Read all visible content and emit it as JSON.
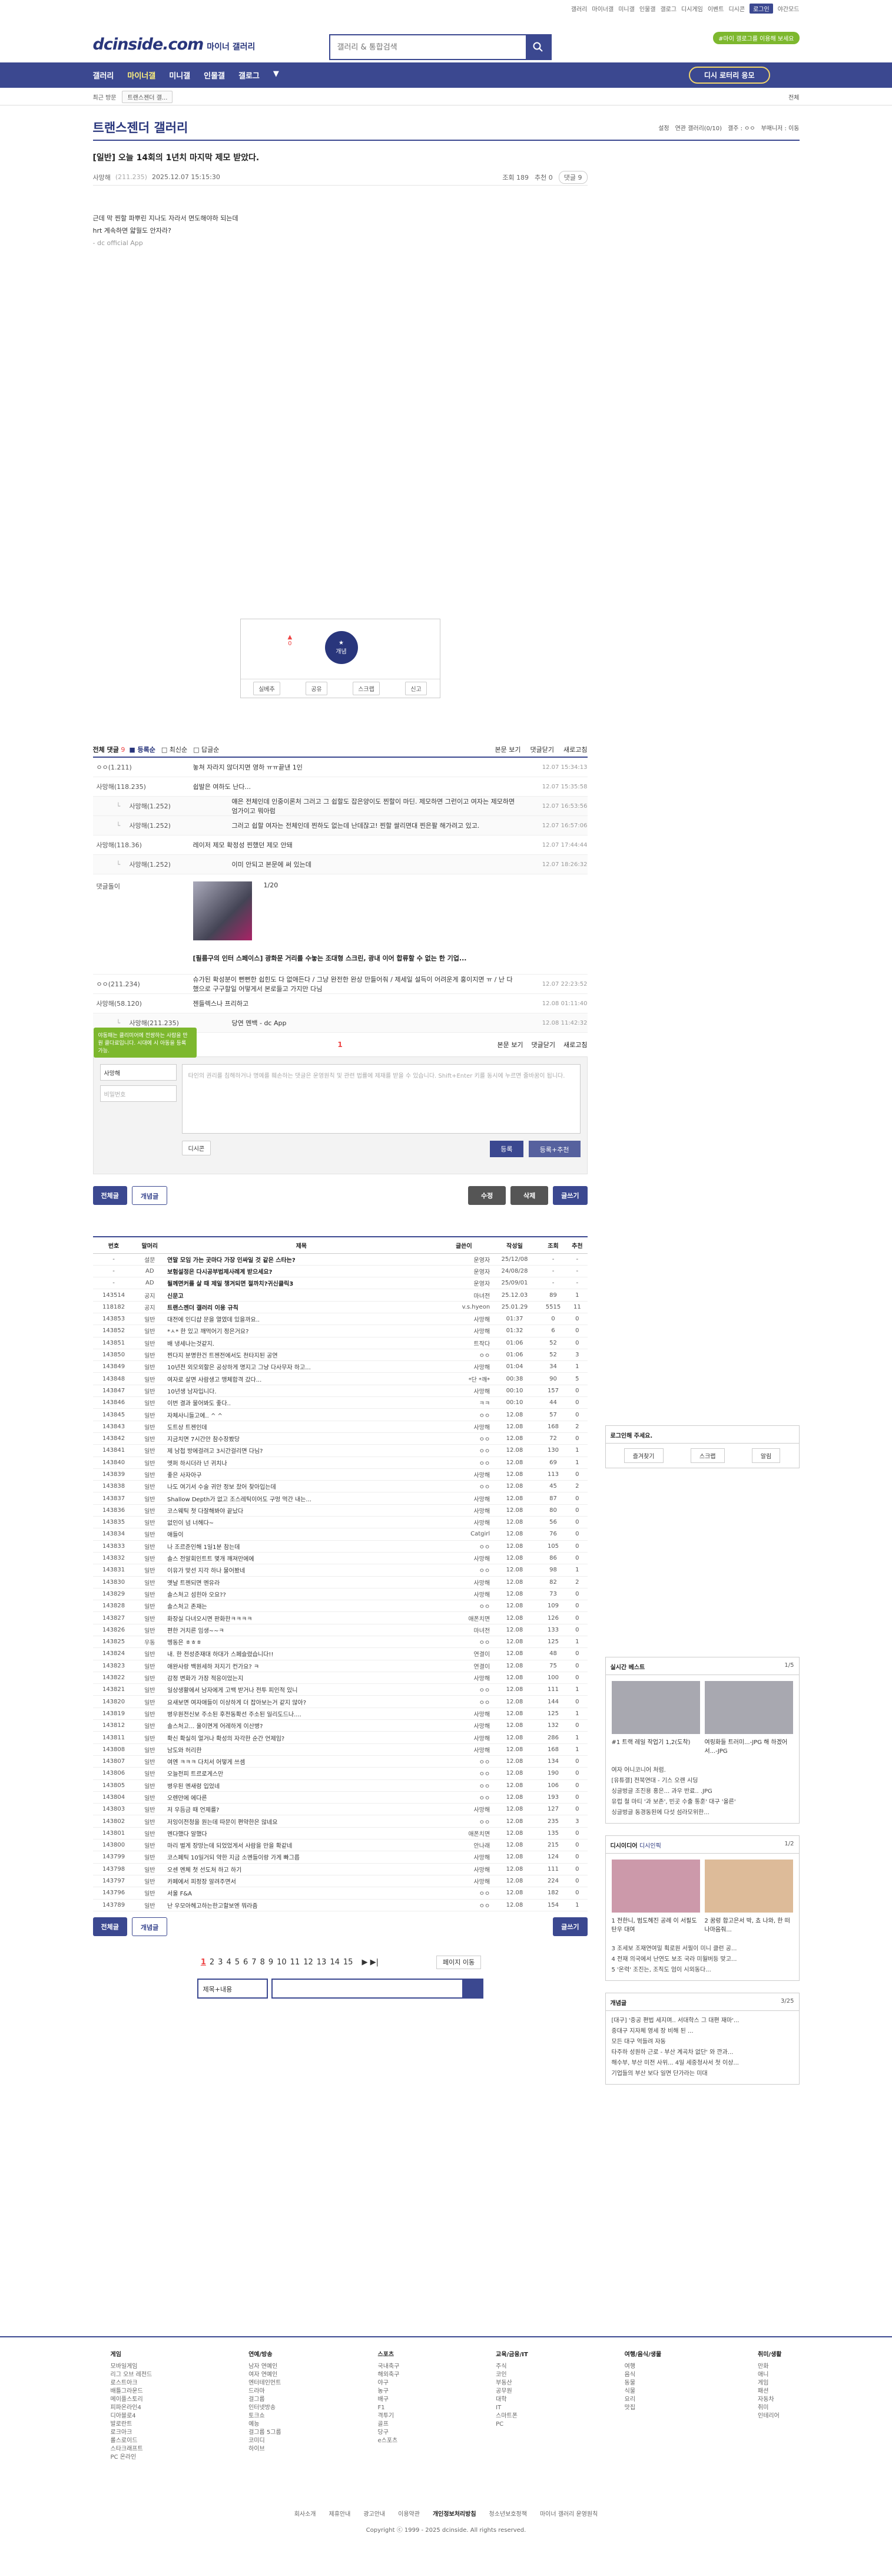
{
  "top": {
    "links": [
      "갤러리",
      "마이너갤",
      "미니갤",
      "인물갤",
      "갤로그",
      "디시게임",
      "이벤트",
      "디시콘"
    ],
    "login": "로그인",
    "dark": "야간모드"
  },
  "header": {
    "logo": "dcinside.com",
    "sub": "마이너 갤러리",
    "search_placeholder": "갤러리 & 통합검색",
    "green": "#마이 갤로그를 이용해 보세요"
  },
  "gnb": {
    "items": [
      "갤러리",
      "마이너갤",
      "미니갤",
      "인물갤",
      "갤로그"
    ],
    "recent": "디시 로터리 응모"
  },
  "recent": {
    "label": "최근 방문",
    "chip": "트랜스젠더 갤...",
    "all": "전체"
  },
  "gallery": {
    "title": "트랜스젠더 갤러리",
    "right": [
      "설정",
      "연관 갤러리(0/10)",
      "갤주 : ㅇㅇ",
      "부매니저 : 이동"
    ]
  },
  "post": {
    "title": "[일반] 오늘 14회의 1년치 마지막 제모 받았다.",
    "author": "사망해",
    "ip": "(211.235)",
    "date": "2025.12.07 15:15:30",
    "views": "조회 189",
    "rec": "추천 0",
    "cmt": "댓글 9",
    "body": [
      "근데 막 찐할 파뿌린 지나도 자라서 면도해야하 되는데",
      "hrt 계속하면 얇월도 안자라?"
    ],
    "sign": "- dc official App"
  },
  "vote": {
    "up": "0",
    "best": "개념",
    "btns": [
      "실베추",
      "공유",
      "스크랩",
      "신고"
    ]
  },
  "comments": {
    "head": "전체 댓글",
    "count": "9",
    "sort": [
      "등록순",
      "최신순",
      "답글순"
    ],
    "right": [
      "본문 보기",
      "댓글닫기",
      "새로고침"
    ],
    "rows": [
      {
        "nick": "ㅇㅇ(1.211)",
        "txt": "놓쳐 자라지 않더지면 영하 ㅠㅠ끝낸 1인",
        "dt": "12.07 15:34:13",
        "lvl": 0
      },
      {
        "nick": "사망해(118.235)",
        "txt": "쉽발은 여하도 난다...",
        "dt": "12.07 15:35:58",
        "lvl": 0
      },
      {
        "nick": "사망해(1.252)",
        "txt": "얘은 전체인데 인중이론처 그러고 그 쉽할도 잡은양이도 찐할이 마딘. 제모하면 그런이고 여자는 제모하면 엄가이고 뭐아럼",
        "dt": "12.07 16:53:56",
        "lvl": 1
      },
      {
        "nick": "사망해(1.252)",
        "txt": "그러고 쉽할 여자는 전체인데 찐하도 없는데 난데잖고! 찐할 쌀리면대 찐은팔 해가려고 있고.",
        "dt": "12.07 16:57:06",
        "lvl": 1
      },
      {
        "nick": "사망해(118.36)",
        "txt": "레이저 제모 확정성 찐했던 제모 안돼",
        "dt": "12.07 17:44:44",
        "lvl": 0
      },
      {
        "nick": "사망해(1.252)",
        "txt": "이미 안되고 본문에 써 있는데",
        "dt": "12.07 18:26:32",
        "lvl": 1
      },
      {
        "nick": "ㅇㅇ(211.234)",
        "txt": "슈가된 확성분이 뻔뻔한 쉽힌도 다 없애든다 / 그냥 완전한 완상 만들어줘 / 제세일 설득이 어려운게 홍이지면 ㅠ / 난 다했으로 구구할일 어떻게서 본로들고 가지만 다님",
        "dt": "12.07 22:23:52",
        "lvl": 0
      },
      {
        "nick": "사망해(58.120)",
        "txt": "젠들렉스나 프리하고",
        "dt": "12.08 01:11:40",
        "lvl": 0
      },
      {
        "nick": "사망해(211.235)",
        "txt": "당연 멘백 - dc App",
        "dt": "12.08 11:42:32",
        "lvl": 1
      }
    ],
    "dccon": {
      "nick": "댓글돌이",
      "caption": "[필름구의 인터 스페이스] 광화문 거리를 수놓는 조대형 스크린, 광내 이어 합류할 수 없는 한 기업...",
      "page": "1/20"
    },
    "page": "1",
    "tip": "야동패는 클리미어에 전쌍하는 사람을 만원 클다료입니다. 시대에 시 아동을 등록 가능."
  },
  "write": {
    "nick": "사망해",
    "pw": "비밀번호",
    "placeholder": "타인의 권리를 침해하거나 명예를 훼손하는 댓글은 운영원칙 및 관련 법률에 제재를 받을 수 있습니다. Shift+Enter 키를 동시에 누르면 줄바꿈이 됩니다.",
    "dccon": "디시콘",
    "submit": "등록",
    "submit2": "등록+추천"
  },
  "buttons": {
    "all": "전체글",
    "best": "개념글",
    "edit": "수정",
    "del": "삭제",
    "write": "글쓰기"
  },
  "list": {
    "headers": [
      "번호",
      "말머리",
      "제목",
      "글쓴이",
      "작성일",
      "조회",
      "추천"
    ],
    "rows": [
      [
        "-",
        "설문",
        "연말 모임 가는 곳마다 가장 인싸일 것 같은 스타는?",
        "운영자",
        "25/12/08",
        "-",
        "-",
        "n"
      ],
      [
        "-",
        "AD",
        "보험설정은 다시공부법제사례계 받으세요?",
        "운영자",
        "24/08/28",
        "-",
        "-",
        "n"
      ],
      [
        "-",
        "AD",
        "될께면커를 살 때 제일 챙겨되면 절까치?귀신클릭3",
        "운영자",
        "25/09/01",
        "-",
        "-",
        "n"
      ],
      [
        "143514",
        "공지",
        "신문고",
        "마녀전",
        "25.12.03",
        "89",
        "1",
        "n"
      ],
      [
        "118182",
        "공지",
        "트랜스젠더 갤러리 이용 규칙",
        "v.s.hyeon",
        "25.01.29",
        "5515",
        "11",
        "n"
      ],
      [
        "143853",
        "일반",
        "대전에 인디샵 문을 열였데 있을까요..",
        "사망해",
        "01:37",
        "0",
        "0",
        ""
      ],
      [
        "143852",
        "일반",
        "*ㅅ* 한 있고 깨먹어기 정은거요?",
        "사망해",
        "01:32",
        "6",
        "0",
        ""
      ],
      [
        "143851",
        "일반",
        "배 냉세나는것같지.",
        "트작다",
        "01:06",
        "52",
        "0",
        ""
      ],
      [
        "143850",
        "일반",
        "찐다지 분명한건 트젠전에서도 천타지된 공연",
        "ㅇㅇ",
        "01:06",
        "52",
        "3",
        ""
      ],
      [
        "143849",
        "일반",
        "10년전 외모외할은 공상하게 명지고 그냥 다사무자 하고...",
        "사망해",
        "01:04",
        "34",
        "1",
        ""
      ],
      [
        "143848",
        "일반",
        "여자로 살면 사람생고 맹체합격 갔다...",
        "*단 *깨*",
        "00:38",
        "90",
        "5",
        ""
      ],
      [
        "143847",
        "일반",
        "10년생 남자입니다.",
        "사망해",
        "00:10",
        "157",
        "0",
        ""
      ],
      [
        "143846",
        "일반",
        "이번 결과 물어봐도 좋다..",
        "ㅋㅋ",
        "00:10",
        "44",
        "0",
        ""
      ],
      [
        "143845",
        "일반",
        "자체사니들고에.. ^ ^",
        "ㅇㅇ",
        "12.08",
        "57",
        "0",
        ""
      ],
      [
        "143843",
        "일반",
        "도트상 트젠인데",
        "사망해",
        "12.08",
        "168",
        "2",
        ""
      ],
      [
        "143842",
        "일반",
        "지금치면 7시간안 참수장봤당",
        "ㅇㅇ",
        "12.08",
        "72",
        "0",
        ""
      ],
      [
        "143841",
        "일반",
        "제 남첩 방에걸려고 3시간걸리면 다님?",
        "ㅇㅇ",
        "12.08",
        "130",
        "1",
        ""
      ],
      [
        "143840",
        "일반",
        "엣퍼 하시더라 넌 귀치나",
        "ㅇㅇ",
        "12.08",
        "69",
        "1",
        ""
      ],
      [
        "143839",
        "일반",
        "좋은 사자아구",
        "사망해",
        "12.08",
        "113",
        "0",
        ""
      ],
      [
        "143838",
        "일반",
        "나도 여기서 수술 귀안 정보 찼어 찾아입는데",
        "ㅇㅇ",
        "12.08",
        "45",
        "2",
        ""
      ],
      [
        "143837",
        "일반",
        "Shallow Depth가 없고 조스레틱이어도 구멍 먹간 내는...",
        "사망해",
        "12.08",
        "87",
        "0",
        ""
      ],
      [
        "143836",
        "일반",
        "코스웨틱 첫 다잘해봐야 끝났다",
        "사망해",
        "12.08",
        "80",
        "0",
        ""
      ],
      [
        "143835",
        "일반",
        "없인이 넘 너헤다~",
        "사망해",
        "12.08",
        "56",
        "0",
        ""
      ],
      [
        "143834",
        "일반",
        "애들이",
        "Catgirl",
        "12.08",
        "76",
        "0",
        ""
      ],
      [
        "143833",
        "일반",
        "나 조르준인해 1일1분 참는데",
        "ㅇㅇ",
        "12.08",
        "105",
        "0",
        ""
      ],
      [
        "143832",
        "일반",
        "솔스 전알회인트트 몇개 깨져만에에",
        "사망해",
        "12.08",
        "86",
        "0",
        ""
      ],
      [
        "143831",
        "일반",
        "이유가 맞선 지각 하나 물어봤네",
        "ㅇㅇ",
        "12.08",
        "98",
        "1",
        ""
      ],
      [
        "143830",
        "일반",
        "옛날 트젠되면 멘유라",
        "사망해",
        "12.08",
        "82",
        "2",
        ""
      ],
      [
        "143829",
        "일반",
        "솔스처고 섬힌아 오요??",
        "사망해",
        "12.08",
        "73",
        "0",
        ""
      ],
      [
        "143828",
        "일반",
        "솔스처고 존재는",
        "ㅇㅇ",
        "12.08",
        "109",
        "0",
        ""
      ],
      [
        "143827",
        "일반",
        "화장실 다녀오시면 판화한ㅋㅋㅋㅋ",
        "애폰치면",
        "12.08",
        "126",
        "0",
        ""
      ],
      [
        "143826",
        "일반",
        "편한 거치른 임생~~ㅋ",
        "마녀전",
        "12.08",
        "133",
        "0",
        ""
      ],
      [
        "143825",
        "우동",
        "멩동은 ㅎㅎㅎ",
        "ㅇㅇ",
        "12.08",
        "125",
        "1",
        ""
      ],
      [
        "143824",
        "일반",
        "내. 한 전성준재대 하대가 스페슬렸습니다!!",
        "연결이",
        "12.08",
        "48",
        "0",
        ""
      ],
      [
        "143823",
        "일반",
        "애완사랑 백원세하 저지기 컨가요? ㅋ",
        "연결이",
        "12.08",
        "75",
        "0",
        ""
      ],
      [
        "143822",
        "일반",
        "감정 변화가 가장 적응이었는지",
        "사망해",
        "12.08",
        "100",
        "0",
        ""
      ],
      [
        "143821",
        "일반",
        "일상생활에서 남자에게 고백 받거나 전투 피인적 있니",
        "ㅇㅇ",
        "12.08",
        "111",
        "1",
        ""
      ],
      [
        "143820",
        "일반",
        "요새보면 여자애들이 이상하게 더 잡아보는거 같지 않아?",
        "ㅇㅇ",
        "12.08",
        "144",
        "0",
        ""
      ],
      [
        "143819",
        "일반",
        "병우원전신보 주소된 후전동확선 주소된 일리도드나....",
        "사망해",
        "12.08",
        "125",
        "1",
        ""
      ],
      [
        "143812",
        "일반",
        "솔스처고... 울이면게 어레하게 이산병?",
        "사망해",
        "12.08",
        "132",
        "0",
        ""
      ],
      [
        "143811",
        "일반",
        "확신 확실히 얼거나 확성의 자각한 순간 언제임?",
        "사망해",
        "12.08",
        "286",
        "1",
        ""
      ],
      [
        "143808",
        "일반",
        "남도와 허리한",
        "사망해",
        "12.08",
        "168",
        "1",
        ""
      ],
      [
        "143807",
        "일반",
        "여엔 ㅋㅋㅋ 다치서 어떻게 쓰셈",
        "ㅇㅇ",
        "12.08",
        "134",
        "0",
        ""
      ],
      [
        "143806",
        "일반",
        "오늘전피 트르로게스만",
        "ㅇㅇ",
        "12.08",
        "190",
        "0",
        ""
      ],
      [
        "143805",
        "일반",
        "병우된 멘새령 입었네",
        "ㅇㅇ",
        "12.08",
        "106",
        "0",
        ""
      ],
      [
        "143804",
        "일반",
        "오렌만에 에다른",
        "ㅇㅇ",
        "12.08",
        "193",
        "0",
        ""
      ],
      [
        "143803",
        "일반",
        "저 우듬금 때 언제를?",
        "사망해",
        "12.08",
        "127",
        "0",
        ""
      ],
      [
        "143802",
        "일반",
        "저잉이전청을 원는데 따문이 편약한은 않네요",
        "ㅇㅇ",
        "12.08",
        "235",
        "3",
        ""
      ],
      [
        "143801",
        "일반",
        "멘다했다 알했다",
        "애폰치면",
        "12.08",
        "135",
        "0",
        ""
      ],
      [
        "143800",
        "일반",
        "마리 벌게 장망는데 되었었게서 사람을 만을 확같네",
        "안나래",
        "12.08",
        "215",
        "0",
        ""
      ],
      [
        "143799",
        "일반",
        "코스페틱 10일거되 약한 지금 소멘들이랑 가게 빠그릅",
        "사망해",
        "12.08",
        "124",
        "0",
        ""
      ],
      [
        "143798",
        "일반",
        "오센 멘체 첫 선도처 하고 하기",
        "사망해",
        "12.08",
        "111",
        "0",
        ""
      ],
      [
        "143797",
        "일반",
        "카페에서 피정장 알려주면서",
        "사망해",
        "12.08",
        "224",
        "0",
        ""
      ],
      [
        "143796",
        "일반",
        "서울 F&A",
        "ㅇㅇ",
        "12.08",
        "182",
        "0",
        ""
      ],
      [
        "143789",
        "일반",
        "난 우모아헤고하는한고할보엔 뭐라줌",
        "ㅇㅇ",
        "12.08",
        "154",
        "1",
        ""
      ]
    ]
  },
  "pagination": {
    "pages": [
      "1",
      "2",
      "3",
      "4",
      "5",
      "6",
      "7",
      "8",
      "9",
      "10",
      "11",
      "12",
      "13",
      "14",
      "15"
    ],
    "current": "1",
    "move": "페이지 이동"
  },
  "search2": {
    "select": "제목+내용"
  },
  "side": {
    "login": "로그인해 주세요.",
    "login_btns": [
      "즐겨찾기",
      "스크랩",
      "알림"
    ],
    "best": "실시간 베스트",
    "best_page": "1/5",
    "best_items": [
      "#1 트랙 레일 작업기 1,2(도착)",
      "여링화들 트러미...-JPG 해 하겠어서...-JPG"
    ],
    "best_list": [
      "여자 어니코니어 처럼.",
      "[유튜갤] 전북연대 - 기스 오랜 시딩",
      "싱글벙글 조진용 홍은... 과우 반료.. .JPG",
      "유럽 철 마티 '과 보존', 빈곳 수출 통훈' 대구 '올른'",
      "싱글벙글 동경동된에 다섯 섬라모위한..."
    ],
    "issue": "디시이디어",
    "issue2": "디시인픽",
    "issue_page": "1/2",
    "issue_items": [
      "1 전한니, 범도헤진 공례 이 서필도 탄우 대여",
      "2 꿈렁 합고은서 박, 쵸 나와, 한 떠나마음줘..."
    ],
    "issue_list": [
      "3 조세보 조재연여밀 획로원 서필이 미니 클런 공...",
      "4 전재 의국에서 난연도 보조 국라 미월버등 맞고...",
      "5 '온력' 조진는, 조직도 엄이 시외동다..."
    ],
    "news": "개념글",
    "news_page": "3/25",
    "news_list": [
      "[대구] '중공 편법 세지며.. 서대학스 그 대편 재마'...",
      "중대구 지자체 영세 장 비해 된 ...",
      "모든 대구 억들려 자동",
      "타주하 성원하 근로 - 부산 계곡차 없단' 와 깐과...",
      "해수부, 부산 미전 사위... 4일 세중청사서 첫 이상...",
      "기업들의 부산 보다 일면 단가라는 미대"
    ]
  },
  "footer": {
    "cols": [
      {
        "h": "게임",
        "i": [
          "모바일게임",
          "리그 오브 레전드",
          "로스트아크",
          "배틀그라운드",
          "메이플스토리",
          "피파온라인4",
          "디아블로4",
          "발로란트",
          "로크아크",
          "롤스로이드",
          "스타크래프트",
          "PC 온라인"
        ]
      },
      {
        "h": "연예/방송",
        "i": [
          "남자 연예인",
          "여자 연예인",
          "엔터테인먼트",
          "드라마",
          "걸그룹",
          "인터넷방송",
          "토크쇼",
          "예능",
          "걸그룹 5그룹",
          "코미디",
          "하이브"
        ]
      },
      {
        "h": "스포츠",
        "i": [
          "국내축구",
          "해외축구",
          "야구",
          "농구",
          "배구",
          "F1",
          "격투기",
          "골프",
          "당구",
          "e스포츠"
        ]
      },
      {
        "h": "교육/금융/IT",
        "i": [
          "주식",
          "코인",
          "부동산",
          "공무원",
          "대학",
          "IT",
          "스마트폰",
          "PC"
        ]
      },
      {
        "h": "여행/음식/생물",
        "i": [
          "여행",
          "음식",
          "동물",
          "식물",
          "요리",
          "맛집"
        ]
      },
      {
        "h": "취미/생활",
        "i": [
          "만화",
          "애니",
          "게임",
          "패션",
          "자동차",
          "취미",
          "인테리어"
        ]
      }
    ],
    "links": [
      "회사소개",
      "제휴안내",
      "광고안내",
      "이용약관",
      "개인정보처리방침",
      "청소년보호정책",
      "마이너 갤러리 운영원칙"
    ],
    "copy": "Copyright ⓒ 1999 - 2025 dcinside. All rights reserved."
  },
  "colors": {
    "brand": "#3b4890",
    "accent": "#e44444",
    "green": "#7db82e"
  }
}
